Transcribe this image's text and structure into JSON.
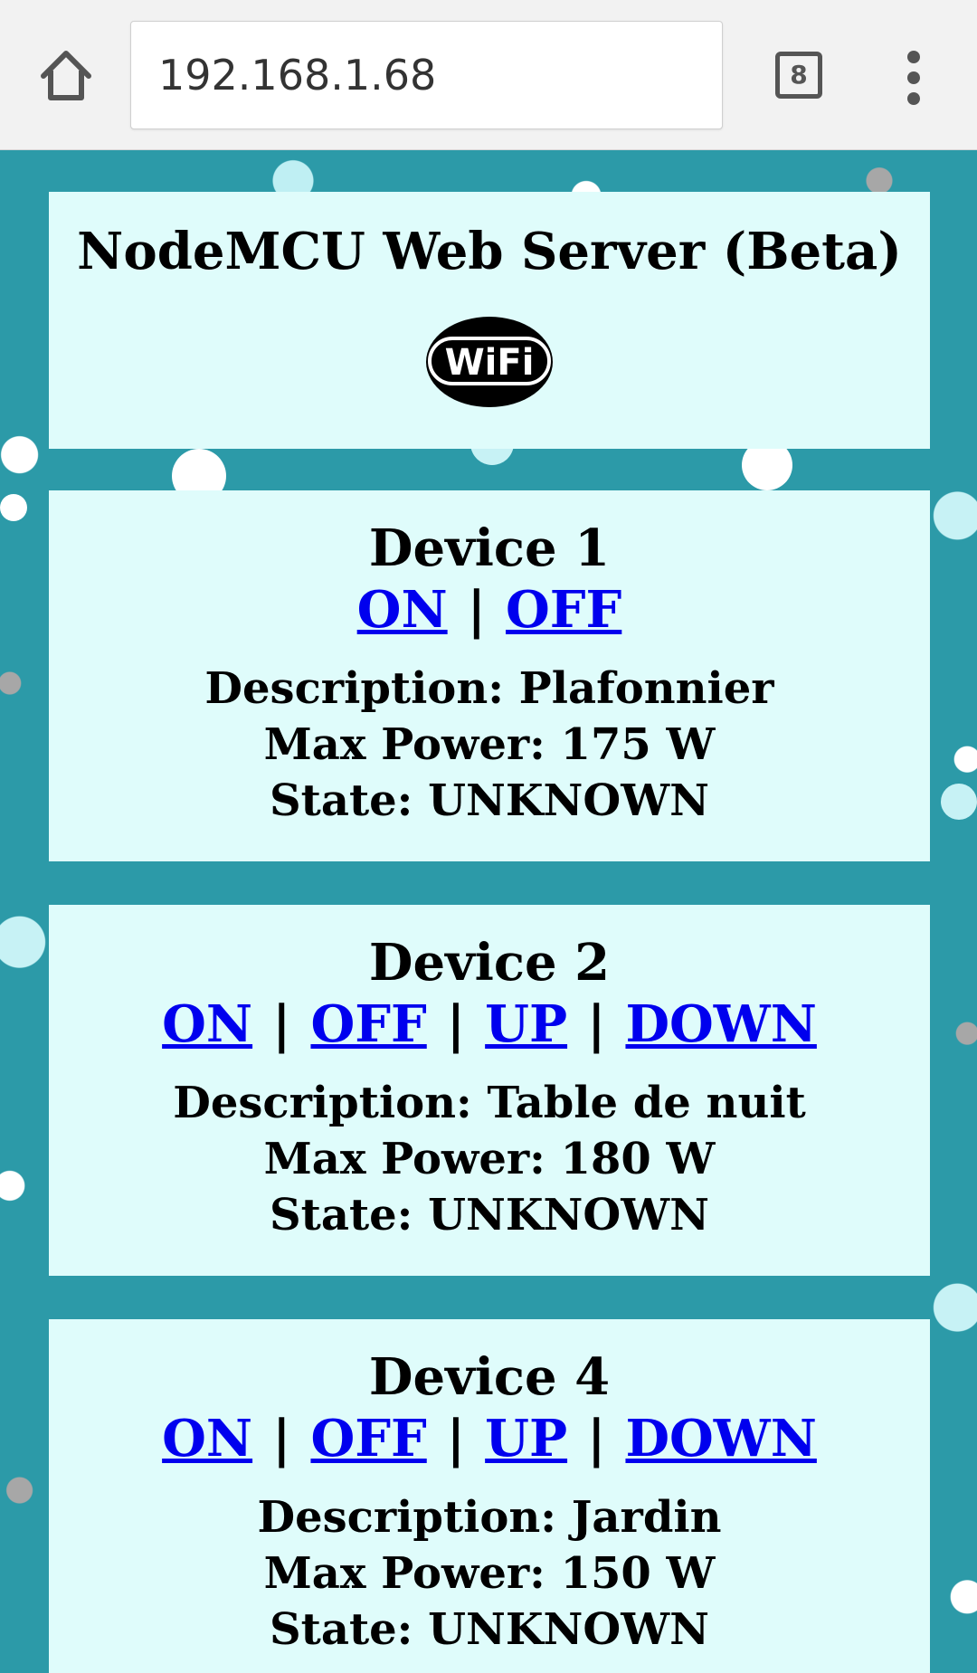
{
  "browser": {
    "url": "192.168.1.68",
    "tab_count": "8"
  },
  "header": {
    "title": "NodeMCU Web Server (Beta)",
    "logo_text": "WiFi"
  },
  "control_separator": "|",
  "devices": [
    {
      "name": "Device 1",
      "controls": [
        "ON",
        "OFF"
      ],
      "description": "Description: Plafonnier",
      "max_power": "Max Power: 175 W",
      "state": "State: UNKNOWN"
    },
    {
      "name": "Device 2",
      "controls": [
        "ON",
        "OFF",
        "UP",
        "DOWN"
      ],
      "description": "Description: Table de nuit",
      "max_power": "Max Power: 180 W",
      "state": "State: UNKNOWN"
    },
    {
      "name": "Device 4",
      "controls": [
        "ON",
        "OFF",
        "UP",
        "DOWN"
      ],
      "description": "Description: Jardin",
      "max_power": "Max Power: 150 W",
      "state": "State: UNKNOWN"
    }
  ],
  "colors": {
    "page_background": "#2c9aa8",
    "card_background": "#dffcfb",
    "link": "#0000ee",
    "toolbar": "#f2f2f2"
  }
}
